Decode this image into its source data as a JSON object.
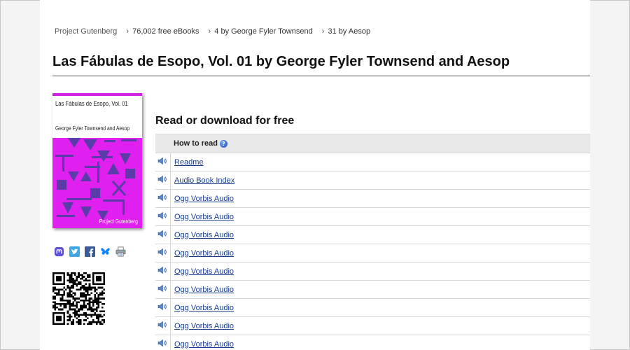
{
  "breadcrumb": {
    "home": "Project Gutenberg",
    "items": [
      "76,002 free eBooks",
      "4 by George Fyler Townsend",
      "31 by Aesop"
    ],
    "separator": "›"
  },
  "title": "Las Fábulas de Esopo, Vol. 01 by George Fyler Townsend and Aesop",
  "cover": {
    "title": "Las Fábulas de Esopo, Vol. 01",
    "author": "George Fyler Townsend and Aesop",
    "label": "Project Gutenberg",
    "colors": {
      "background": "#e020ee",
      "shapes": "#5a3ca8",
      "topbar": "#d024e0"
    }
  },
  "share_icons": [
    "mastodon-icon",
    "twitter-icon",
    "facebook-icon",
    "bluesky-icon",
    "print-icon"
  ],
  "read_section": {
    "heading": "Read or download for free",
    "header_label": "How to read",
    "help_glyph": "?",
    "rows": [
      "Readme",
      "Audio Book Index",
      "Ogg Vorbis Audio",
      "Ogg Vorbis Audio",
      "Ogg Vorbis Audio",
      "Ogg Vorbis Audio",
      "Ogg Vorbis Audio",
      "Ogg Vorbis Audio",
      "Ogg Vorbis Audio",
      "Ogg Vorbis Audio",
      "Ogg Vorbis Audio"
    ]
  },
  "colors": {
    "link": "#1a3c8e",
    "table_header": "#e8e8e8"
  }
}
